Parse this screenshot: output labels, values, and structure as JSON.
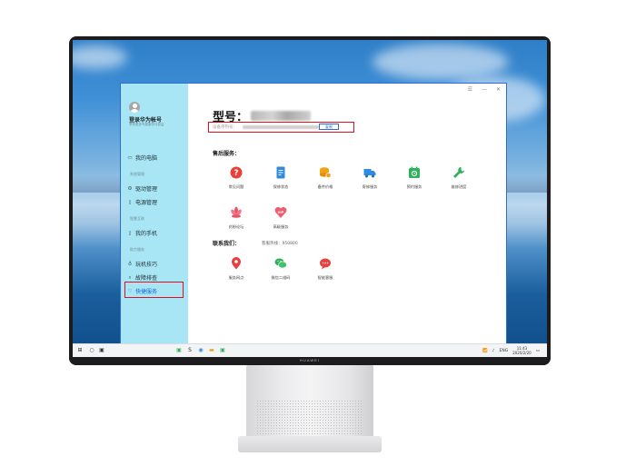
{
  "device": {
    "brand": "HUAWEI"
  },
  "sidebar": {
    "login_title": "登录华为帐号",
    "login_subtitle": "享受更多专属服务与权益",
    "items": [
      {
        "label": "我的电脑",
        "icon": "monitor-icon"
      },
      {
        "group": "系统管理"
      },
      {
        "label": "驱动管理",
        "icon": "gear-icon"
      },
      {
        "label": "电源管理",
        "icon": "battery-icon"
      },
      {
        "group": "智慧互联"
      },
      {
        "label": "我的手机",
        "icon": "phone-icon"
      },
      {
        "group": "助力服务"
      },
      {
        "label": "玩机技巧",
        "icon": "tips-icon"
      },
      {
        "label": "故障排查",
        "icon": "search-icon"
      },
      {
        "label": "快捷服务",
        "icon": "heart-icon",
        "active": true
      }
    ]
  },
  "window_controls": [
    "☰",
    "—",
    "✕"
  ],
  "model": {
    "label": "型号："
  },
  "serial": {
    "label": "设备序列号：",
    "copy_button": "复制"
  },
  "after_sales": {
    "title": "售后服务：",
    "items": [
      {
        "label": "常见问题",
        "icon": "question-icon",
        "color": "#e8403a"
      },
      {
        "label": "保修状态",
        "icon": "document-icon",
        "color": "#2f8be0"
      },
      {
        "label": "备件价格",
        "icon": "coins-icon",
        "color": "#f2a216"
      },
      {
        "label": "寄修服务",
        "icon": "truck-icon",
        "color": "#2f8be0"
      },
      {
        "label": "预约服务",
        "icon": "calendar-icon",
        "color": "#2fb15c"
      },
      {
        "label": "维修进度",
        "icon": "wrench-icon",
        "color": "#2fb15c"
      },
      {
        "label": "花粉论坛",
        "icon": "flower-icon",
        "color": "#e8546a"
      },
      {
        "label": "高级服务",
        "icon": "vip-icon",
        "color": "#ef5b6f"
      }
    ]
  },
  "contact": {
    "title": "联系我们：",
    "hotline": "客服热线：950800",
    "items": [
      {
        "label": "服务网点",
        "icon": "location-icon",
        "color": "#e8403a"
      },
      {
        "label": "微信二维码",
        "icon": "wechat-icon",
        "color": "#2fb15c"
      },
      {
        "label": "智能客服",
        "icon": "chat-icon",
        "color": "#e8403a"
      }
    ]
  },
  "taskbar": {
    "tray_text": "ENG",
    "time": "11:43",
    "date": "2020/2/20"
  }
}
